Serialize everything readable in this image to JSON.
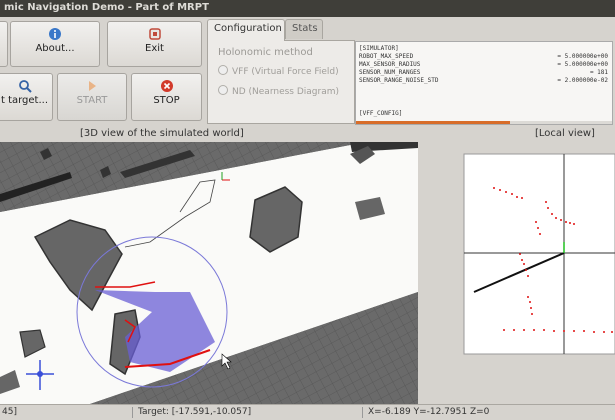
{
  "window": {
    "title": "mic Navigation Demo - Part of MRPT"
  },
  "toolbar": {
    "about_label": "About...",
    "exit_label": "Exit",
    "target_label": "t target...",
    "start_label": "START",
    "stop_label": "STOP"
  },
  "tabs": [
    {
      "label": "Configuration",
      "active": true
    },
    {
      "label": "Stats",
      "active": false
    }
  ],
  "holonomic": {
    "title": "Holonomic method",
    "options": [
      {
        "label": "VFF (Virtual Force Field)",
        "selected": true
      },
      {
        "label": "ND (Nearness Diagram)",
        "selected": false
      }
    ]
  },
  "config": {
    "lines": [
      {
        "key": "[SIMULATOR]",
        "value": ""
      },
      {
        "key": "ROBOT_MAX_SPEED",
        "value": "= 5.000000e+00"
      },
      {
        "key": "MAX_SENSOR_RADIUS",
        "value": "= 5.000000e+00"
      },
      {
        "key": "SENSOR_NUM_RANGES",
        "value": "= 181"
      },
      {
        "key": "SENSOR_RANGE_NOISE_STD",
        "value": "= 2.000000e-02"
      },
      {
        "key": "[VFF_CONFIG]",
        "value": ""
      }
    ],
    "progress": 0.6
  },
  "views": {
    "main_label": "[3D view of the simulated world]",
    "local_label": "[Local view]"
  },
  "status": {
    "left": "45]",
    "target": "Target: [-17.591,-10.057]",
    "coords": "X=-6.189 Y=-12.7951 Z=0"
  },
  "colors": {
    "accent": "#d86d2a",
    "scan": "#e01010",
    "sweep": "#6a5fd6",
    "obstacle": "#6b6b6b"
  }
}
